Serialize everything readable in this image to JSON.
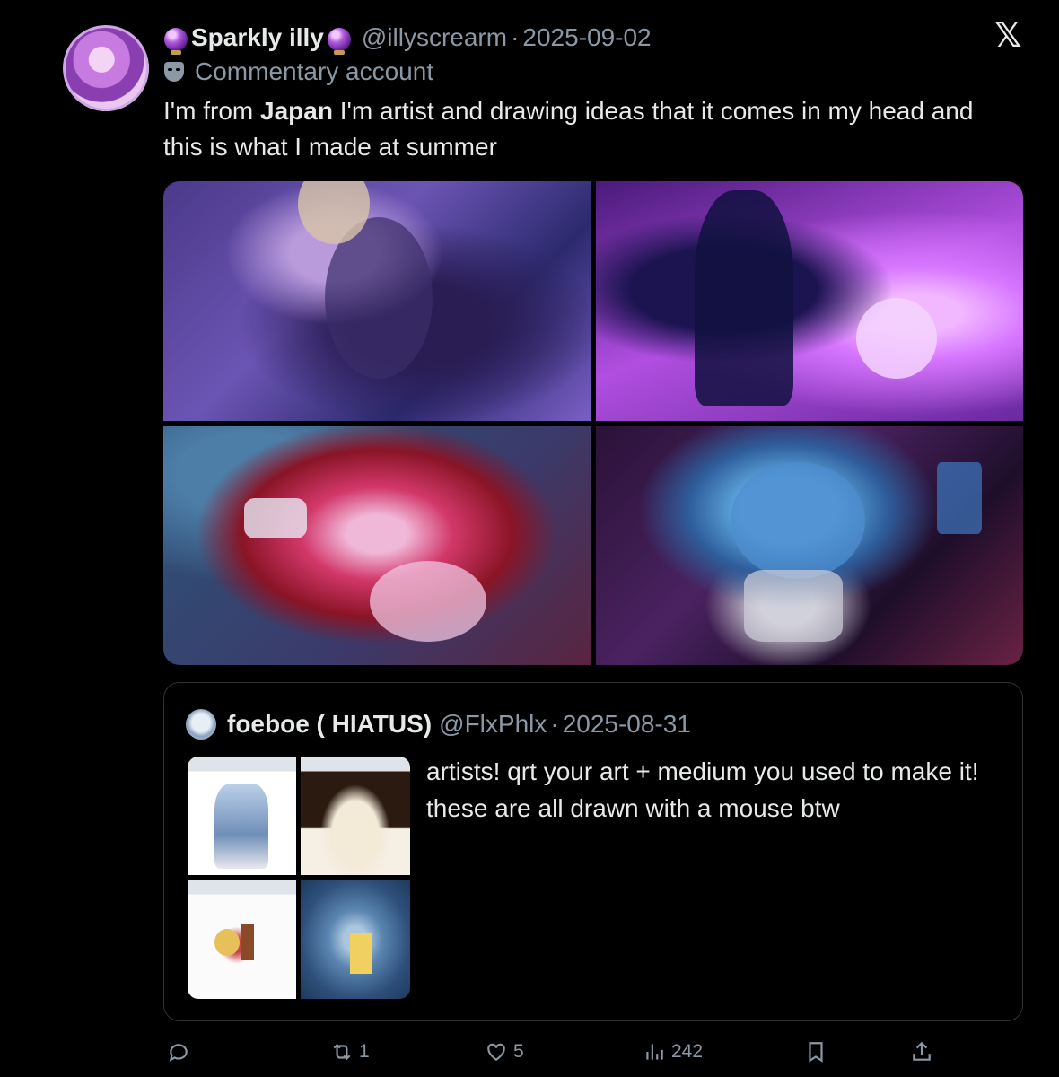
{
  "post": {
    "author_name": "Sparkly illy",
    "handle": "@illyscrearm",
    "separator": "·",
    "date": "2025-09-02",
    "label": "Commentary account",
    "text_before": "I'm from ",
    "text_bold": "Japan",
    "text_after": " I'm artist and drawing ideas that it comes in my head and this is what I made at summer"
  },
  "media": {
    "images": [
      {
        "description_icon": "image"
      },
      {
        "description_icon": "image"
      },
      {
        "description_icon": "image"
      },
      {
        "description_icon": "image"
      }
    ]
  },
  "quote": {
    "author_name": "foeboe ( HIATUS)",
    "handle": "@FlxPhlx",
    "separator": "·",
    "date": "2025-08-31",
    "text": "artists! qrt your art + medium you used to make it! these are all drawn with a mouse btw"
  },
  "actions": {
    "reply_count": "",
    "repost_count": "1",
    "like_count": "5",
    "views_count": "242"
  },
  "colors": {
    "background": "#000000",
    "text": "#e7e9ea",
    "secondary": "#8b98a5",
    "border": "#2f3336"
  }
}
